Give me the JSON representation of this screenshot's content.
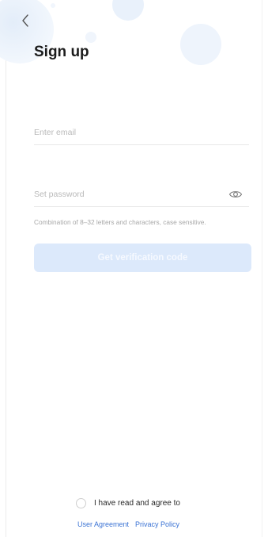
{
  "header": {
    "back_icon": "chevron-left-icon",
    "title": "Sign up"
  },
  "form": {
    "email_placeholder": "Enter email",
    "email_value": "",
    "password_placeholder": "Set password",
    "password_value": "",
    "password_toggle_icon": "eye-icon",
    "password_hint": "Combination of 8–32 letters and characters, case sensitive.",
    "submit_label": "Get verification code"
  },
  "agreement": {
    "checked": false,
    "text": "I have read and agree to",
    "user_agreement": "User Agreement",
    "privacy_policy": "Privacy Policy"
  },
  "colors": {
    "accent": "#3b73d4",
    "button_disabled": "#dce9fb"
  }
}
